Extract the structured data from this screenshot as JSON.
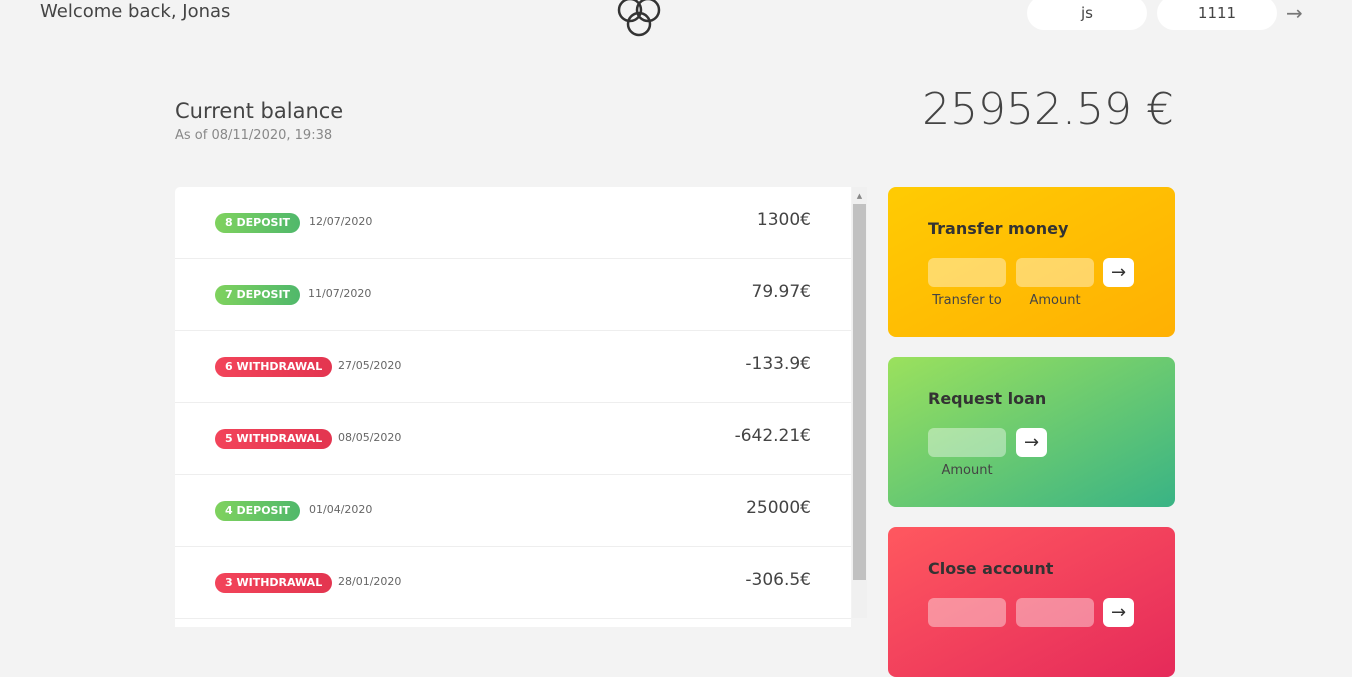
{
  "header": {
    "welcome": "Welcome back, Jonas",
    "logo_icon": "bankist-logo-icon",
    "login_user_value": "js",
    "login_pin_value": "1111",
    "login_arrow": "→"
  },
  "balance": {
    "label": "Current balance",
    "date": "As of 08/11/2020, 19:38",
    "value": "25952.59 €"
  },
  "movements": [
    {
      "type": "8 DEPOSIT",
      "kind": "deposit",
      "date": "12/07/2020",
      "value": "1300€"
    },
    {
      "type": "7 DEPOSIT",
      "kind": "deposit",
      "date": "11/07/2020",
      "value": "79.97€"
    },
    {
      "type": "6 WITHDRAWAL",
      "kind": "withdrawal",
      "date": "27/05/2020",
      "value": "-133.9€"
    },
    {
      "type": "5 WITHDRAWAL",
      "kind": "withdrawal",
      "date": "08/05/2020",
      "value": "-642.21€"
    },
    {
      "type": "4 DEPOSIT",
      "kind": "deposit",
      "date": "01/04/2020",
      "value": "25000€"
    },
    {
      "type": "3 WITHDRAWAL",
      "kind": "withdrawal",
      "date": "28/01/2020",
      "value": "-306.5€"
    }
  ],
  "operations": {
    "transfer": {
      "title": "Transfer money",
      "label_to": "Transfer to",
      "label_amount": "Amount",
      "button": "→"
    },
    "loan": {
      "title": "Request loan",
      "label_amount": "Amount",
      "button": "→"
    },
    "close": {
      "title": "Close account",
      "button": "→"
    }
  },
  "colors": {
    "deposit": "#50b86b",
    "withdrawal": "#e33550",
    "transfer": "#ffb003",
    "loan": "#39b385",
    "close": "#e52a5a"
  }
}
